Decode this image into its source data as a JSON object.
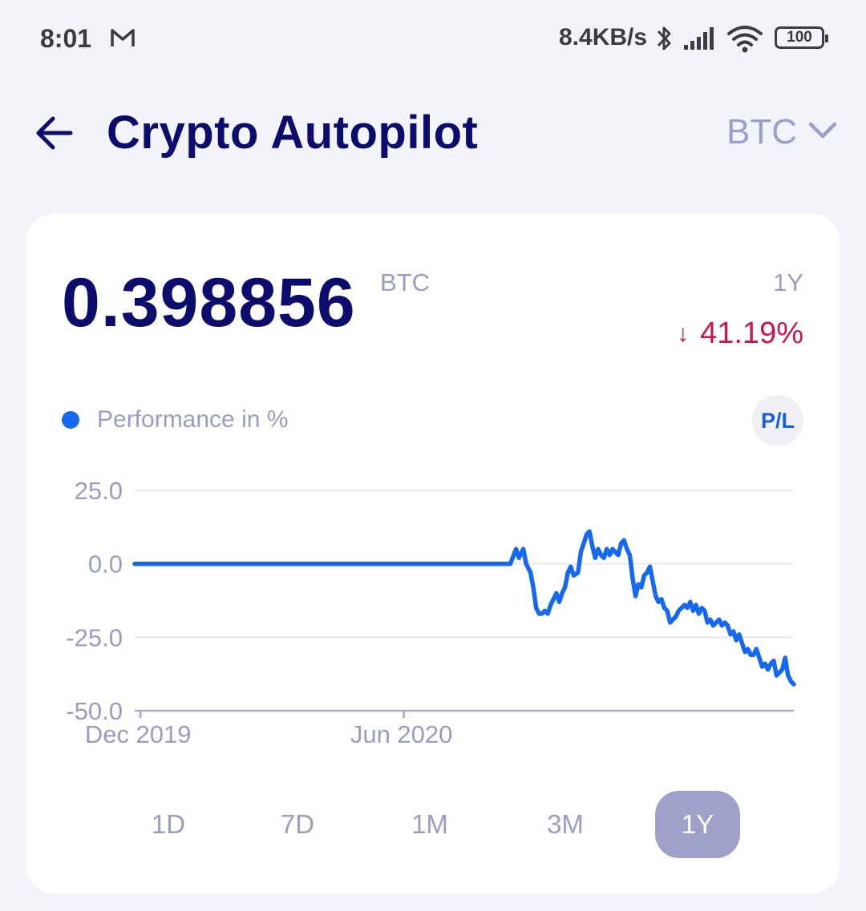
{
  "status_bar": {
    "time": "8:01",
    "speed": "8.4KB/s",
    "battery": "100"
  },
  "header": {
    "title": "Crypto Autopilot",
    "currency": "BTC"
  },
  "card": {
    "balance": "0.398856",
    "balance_unit": "BTC",
    "period": "1Y",
    "change_arrow": "↓",
    "change": "41.19%",
    "legend": "Performance in %",
    "pl_button": "P/L"
  },
  "range_tabs": [
    {
      "label": "1D",
      "active": false
    },
    {
      "label": "7D",
      "active": false
    },
    {
      "label": "1M",
      "active": false
    },
    {
      "label": "3M",
      "active": false
    },
    {
      "label": "1Y",
      "active": true
    }
  ],
  "colors": {
    "line": "#1668ef",
    "negative": "#c8174a",
    "title": "#0c0c6c"
  },
  "chart_data": {
    "type": "line",
    "title": "",
    "xlabel": "",
    "ylabel": "",
    "ylim": [
      -50,
      25
    ],
    "yticks": [
      25.0,
      0.0,
      -25.0,
      -50.0
    ],
    "ytick_labels": [
      "25.0",
      "0.0",
      "-25.0",
      "-50.0"
    ],
    "xticks": [
      {
        "label": "Dec 2019",
        "x": "2019-12-01"
      },
      {
        "label": "Jun 2020",
        "x": "2020-06-01"
      }
    ],
    "grid": true,
    "legend": "top-left",
    "series": [
      {
        "name": "Performance in %",
        "x": [
          "2019-11-27",
          "2020-08-14",
          "2020-08-18",
          "2020-08-20",
          "2020-08-23",
          "2020-08-25",
          "2020-08-28",
          "2020-08-30",
          "2020-09-01",
          "2020-09-03",
          "2020-09-05",
          "2020-09-07",
          "2020-09-09",
          "2020-09-11",
          "2020-09-13",
          "2020-09-15",
          "2020-09-17",
          "2020-09-19",
          "2020-09-21",
          "2020-09-23",
          "2020-09-25",
          "2020-09-27",
          "2020-09-30",
          "2020-10-02",
          "2020-10-04",
          "2020-10-06",
          "2020-10-08",
          "2020-10-10",
          "2020-10-12",
          "2020-10-14",
          "2020-10-16",
          "2020-10-18",
          "2020-10-20",
          "2020-10-22",
          "2020-10-24",
          "2020-10-26",
          "2020-10-28",
          "2020-10-30",
          "2020-11-01",
          "2020-11-03",
          "2020-11-05",
          "2020-11-07",
          "2020-11-09",
          "2020-11-11",
          "2020-11-13",
          "2020-11-15",
          "2020-11-17",
          "2020-11-19",
          "2020-11-21",
          "2020-11-23",
          "2020-11-25",
          "2020-11-27",
          "2020-11-29",
          "2020-12-01",
          "2020-12-03",
          "2020-12-05",
          "2020-12-07",
          "2020-12-09",
          "2020-12-11",
          "2020-12-13",
          "2020-12-15",
          "2020-12-17",
          "2020-12-19",
          "2020-12-21",
          "2020-12-23",
          "2020-12-25",
          "2020-12-27",
          "2020-12-29",
          "2020-12-31",
          "2021-01-02",
          "2021-01-04",
          "2021-01-06",
          "2021-01-08",
          "2021-01-10",
          "2021-01-12",
          "2021-01-14",
          "2021-01-16",
          "2021-01-18",
          "2021-01-20",
          "2021-01-22",
          "2021-01-24",
          "2021-01-26",
          "2021-01-28",
          "2021-01-30",
          "2021-02-01",
          "2021-02-03",
          "2021-02-05",
          "2021-02-07",
          "2021-02-09",
          "2021-02-11",
          "2021-02-13",
          "2021-02-15",
          "2021-02-17",
          "2021-02-19",
          "2021-02-21",
          "2021-02-23",
          "2021-02-25",
          "2021-02-27"
        ],
        "y": [
          0,
          0,
          5,
          2,
          5,
          0,
          -3,
          -8,
          -15,
          -17,
          -17,
          -16,
          -17,
          -14,
          -12,
          -10,
          -13,
          -10,
          -8,
          -3,
          -1,
          -4,
          -3,
          4,
          7,
          10,
          11,
          6,
          2,
          5,
          3,
          2,
          5,
          3,
          5,
          4,
          3,
          7,
          8,
          5,
          3,
          -5,
          -11,
          -7,
          -8,
          -4,
          -3,
          -1,
          -6,
          -11,
          -13,
          -12,
          -15,
          -16,
          -20,
          -19,
          -18,
          -16,
          -15,
          -14,
          -15,
          -13,
          -16,
          -14,
          -17,
          -15,
          -16,
          -20,
          -19,
          -21,
          -20,
          -19,
          -21,
          -20,
          -21,
          -24,
          -23,
          -26,
          -24,
          -27,
          -30,
          -29,
          -31,
          -31,
          -29,
          -32,
          -35,
          -34,
          -36,
          -34,
          -33,
          -38,
          -37,
          -36,
          -32,
          -38,
          -40,
          -41
        ]
      }
    ]
  }
}
